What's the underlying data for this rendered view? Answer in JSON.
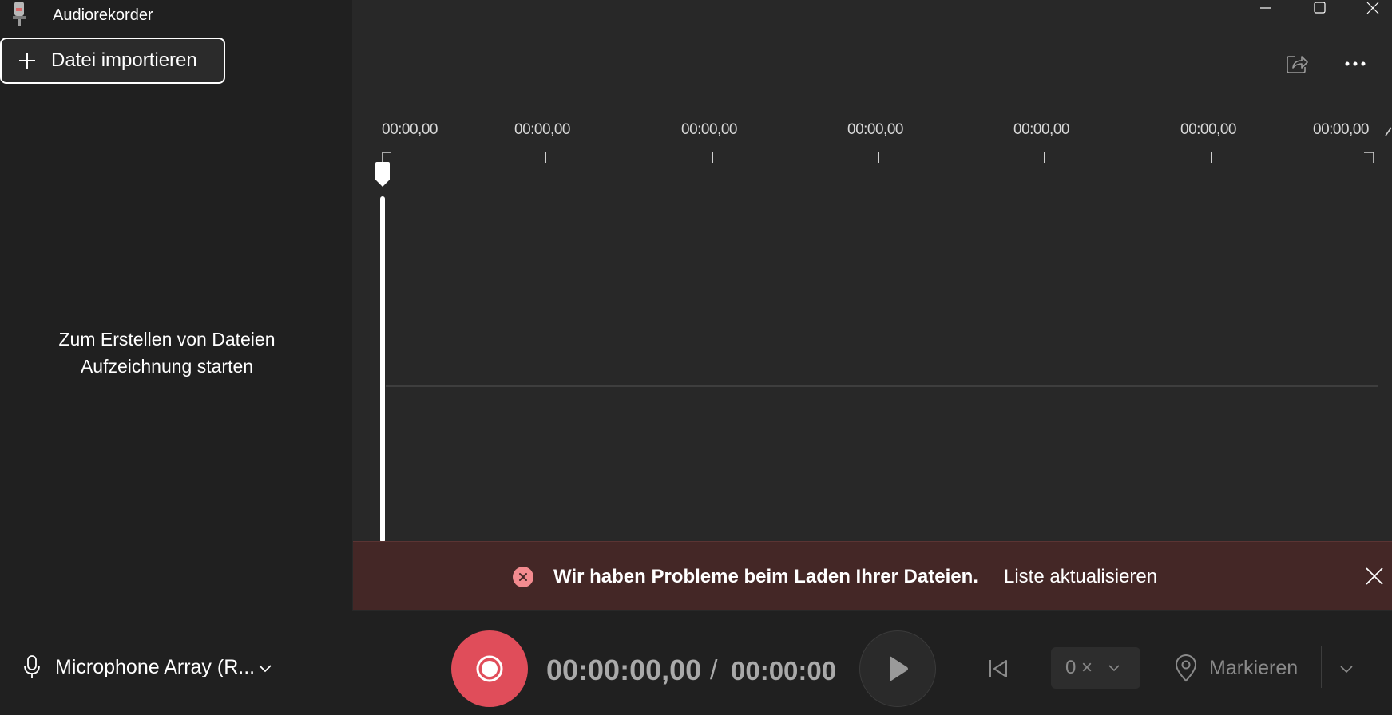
{
  "app": {
    "title": "Audiorekorder"
  },
  "sidebar": {
    "import_label": "Datei importieren",
    "empty_line1": "Zum Erstellen von Dateien",
    "empty_line2": "Aufzeichnung starten"
  },
  "timeline": {
    "ticks": [
      "00:00,00",
      "00:00,00",
      "00:00,00",
      "00:00,00",
      "00:00,00",
      "00:00,00",
      "00:00,00"
    ]
  },
  "error_banner": {
    "message": "Wir haben Probleme beim Laden Ihrer Dateien.",
    "action": "Liste aktualisieren"
  },
  "player": {
    "microphone": "Microphone Array (R...",
    "current_time": "00:00:00,00",
    "separator": "/",
    "total_time": "00:00:00",
    "speed": "0 ×",
    "mark_label": "Markieren"
  },
  "colors": {
    "record": "#e04d5a",
    "error_bg": "#442726",
    "error_icon": "#f38b8f"
  },
  "icons": [
    "app-microphone-icon",
    "plus-icon",
    "minimize-icon",
    "maximize-icon",
    "close-icon",
    "share-icon",
    "more-icon",
    "error-icon",
    "dismiss-icon",
    "microphone-icon",
    "chevron-down-icon",
    "record-icon",
    "play-icon",
    "skip-back-icon",
    "location-marker-icon"
  ]
}
